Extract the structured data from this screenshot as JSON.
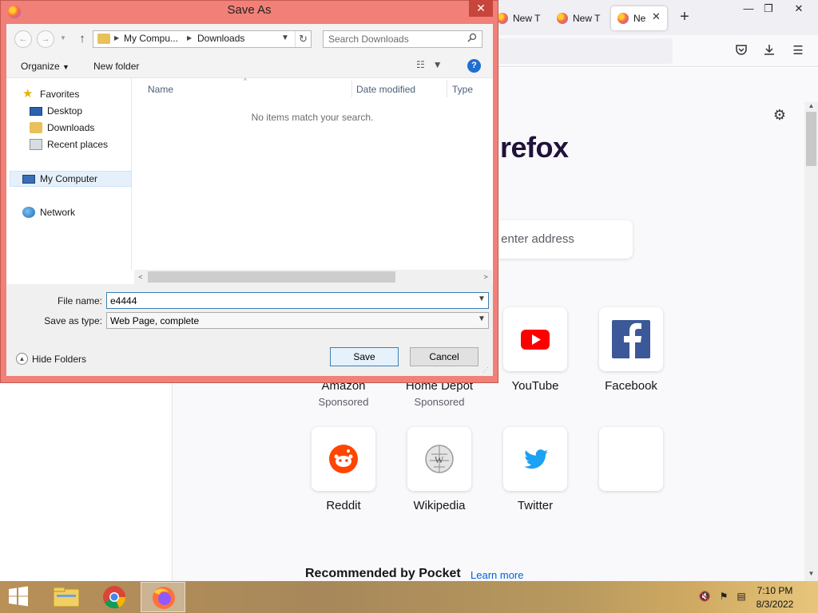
{
  "browser": {
    "tabs": [
      {
        "label": "New T"
      },
      {
        "label": "New T"
      },
      {
        "label": "Ne"
      }
    ],
    "brand_partial": "refox",
    "search_hint": "r enter address",
    "top_sites": [
      {
        "label": "Amazon",
        "sub": "Sponsored"
      },
      {
        "label": "Home Depot",
        "sub": "Sponsored"
      },
      {
        "label": "YouTube",
        "icon": "youtube-icon",
        "color": "#ff0000"
      },
      {
        "label": "Facebook",
        "icon": "facebook-icon",
        "color": "#3b5998"
      },
      {
        "label": "Reddit",
        "icon": "reddit-icon",
        "color": "#ff4500"
      },
      {
        "label": "Wikipedia",
        "icon": "wikipedia-icon",
        "color": "#9a9a9a"
      },
      {
        "label": "Twitter",
        "icon": "twitter-icon",
        "color": "#1da1f2"
      },
      {
        "label": ""
      }
    ],
    "pocket_title": "Recommended by Pocket",
    "pocket_link": "Learn more"
  },
  "dialog": {
    "title": "Save As",
    "breadcrumb": [
      "My Compu...",
      "Downloads"
    ],
    "search_placeholder": "Search Downloads",
    "toolbar": {
      "organize": "Organize",
      "new_folder": "New folder"
    },
    "tree": {
      "favorites": "Favorites",
      "desktop": "Desktop",
      "downloads": "Downloads",
      "recent": "Recent places",
      "my_computer": "My Computer",
      "network": "Network"
    },
    "columns": {
      "name": "Name",
      "date": "Date modified",
      "type": "Type"
    },
    "empty_message": "No items match your search.",
    "file_name_label": "File name:",
    "file_name_value": "e4444",
    "save_type_label": "Save as type:",
    "save_type_value": "Web Page, complete",
    "hide_folders": "Hide Folders",
    "save_button": "Save",
    "cancel_button": "Cancel"
  },
  "taskbar": {
    "time": "7:10 PM",
    "date": "8/3/2022"
  },
  "colors": {
    "dialog_frame": "#f08078",
    "close_button": "#c7453b",
    "link": "#0061e0"
  }
}
